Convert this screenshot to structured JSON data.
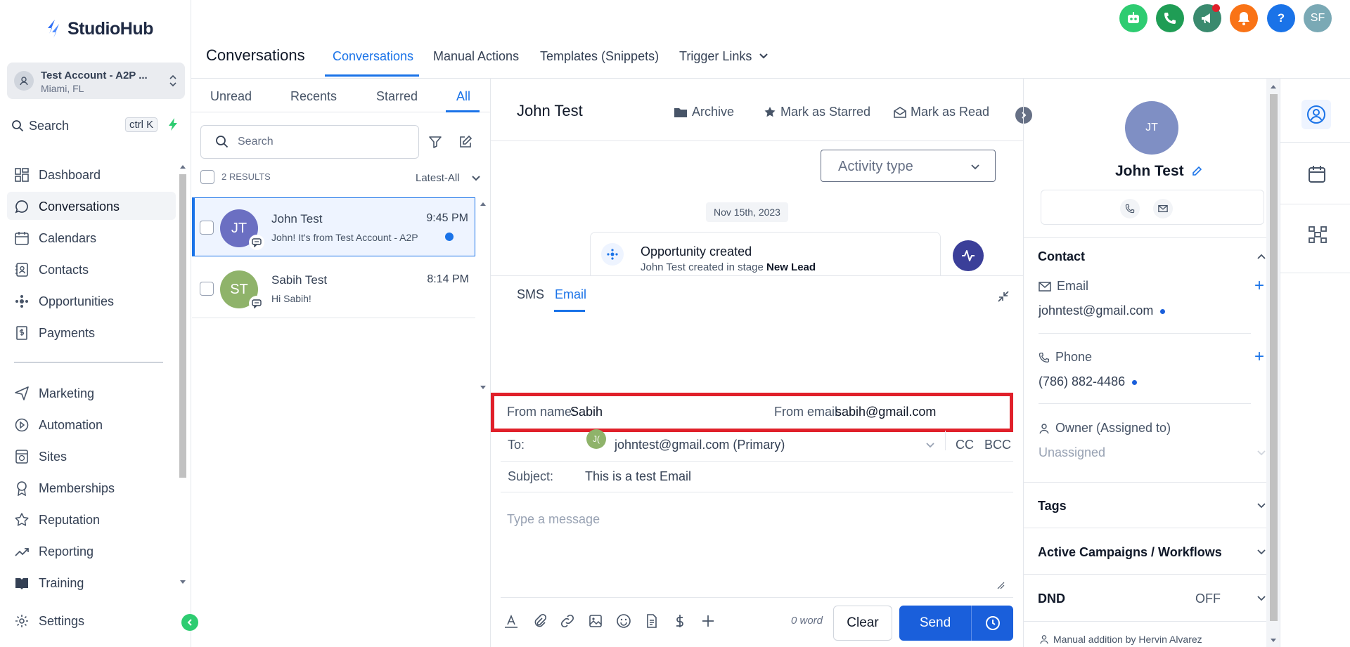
{
  "brand": {
    "name": "StudioHub"
  },
  "account": {
    "name": "Test Account - A2P ...",
    "location": "Miami, FL"
  },
  "sidebar": {
    "search_label": "Search",
    "search_shortcut": "ctrl K",
    "items": [
      {
        "label": "Dashboard",
        "icon": "dashboard-icon"
      },
      {
        "label": "Conversations",
        "icon": "chat-icon",
        "active": true
      },
      {
        "label": "Calendars",
        "icon": "calendar-icon"
      },
      {
        "label": "Contacts",
        "icon": "contacts-icon"
      },
      {
        "label": "Opportunities",
        "icon": "opportunities-icon"
      },
      {
        "label": "Payments",
        "icon": "payments-icon"
      },
      {
        "label": "Marketing",
        "icon": "send-icon"
      },
      {
        "label": "Automation",
        "icon": "automation-icon"
      },
      {
        "label": "Sites",
        "icon": "sites-icon"
      },
      {
        "label": "Memberships",
        "icon": "memberships-icon"
      },
      {
        "label": "Reputation",
        "icon": "star-icon"
      },
      {
        "label": "Reporting",
        "icon": "trend-icon"
      },
      {
        "label": "Training",
        "icon": "book-icon"
      }
    ],
    "settings_label": "Settings"
  },
  "header": {
    "title": "Conversations",
    "tabs": [
      "Conversations",
      "Manual Actions",
      "Templates (Snippets)",
      "Trigger Links"
    ],
    "user_initials": "SF",
    "help_label": "?"
  },
  "list": {
    "tabs": [
      "Unread",
      "Recents",
      "Starred",
      "All"
    ],
    "search_placeholder": "Search",
    "results": "2 RESULTS",
    "sort": "Latest-All",
    "conversations": [
      {
        "initials": "JT",
        "name": "John Test",
        "time": "9:45 PM",
        "preview": "John! It's from Test Account - A2P",
        "color": "#6b6fc2",
        "unread": true
      },
      {
        "initials": "ST",
        "name": "Sabih Test",
        "time": "8:14 PM",
        "preview": "Hi Sabih!",
        "color": "#8fb36a"
      }
    ]
  },
  "conversation": {
    "name": "John Test",
    "actions": [
      "Archive",
      "Mark as Starred",
      "Mark as Read"
    ],
    "activity_type": "Activity type",
    "date": "Nov 15th, 2023",
    "opportunity": {
      "title": "Opportunity created",
      "sub_prefix": "John Test created in stage ",
      "stage": "New Lead"
    }
  },
  "composer": {
    "tabs": [
      "SMS",
      "Email"
    ],
    "from_name_label": "From name:",
    "from_name": "Sabih",
    "from_email_label": "From email:",
    "from_email": "sabih@gmail.com",
    "to_label": "To:",
    "to_avatar": "J(",
    "to_value": "johntest@gmail.com (Primary)",
    "cc": "CC",
    "bcc": "BCC",
    "subject_label": "Subject:",
    "subject": "This is a test Email",
    "message_placeholder": "Type a message",
    "word_count": "0 word",
    "clear": "Clear",
    "send": "Send"
  },
  "contact": {
    "initials": "JT",
    "name": "John Test",
    "section_contact": "Contact",
    "email_label": "Email",
    "email": "johntest@gmail.com",
    "phone_label": "Phone",
    "phone": "(786) 882-4486",
    "owner_label": "Owner (Assigned to)",
    "owner": "Unassigned",
    "tags": "Tags",
    "campaigns": "Active Campaigns / Workflows",
    "dnd": "DND",
    "dnd_value": "OFF",
    "footer_note": "Manual addition by Hervin Alvarez"
  },
  "colors": {
    "accent": "#1a73e8",
    "send": "#1a5fdb",
    "highlight": "#e0202a"
  }
}
